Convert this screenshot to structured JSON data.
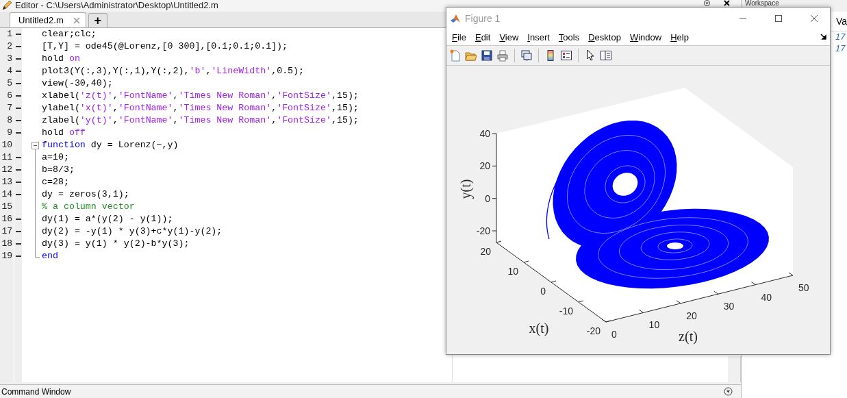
{
  "editor": {
    "title": "Editor - C:\\Users\\Administrator\\Desktop\\Untitled2.m",
    "tabs": [
      {
        "label": "Untitled2.m",
        "selected": true
      }
    ],
    "new_tab_button": "+",
    "lines": [
      {
        "number": "1",
        "executable": true,
        "segments": [
          {
            "kind": "plain",
            "text": "clear;clc;"
          }
        ]
      },
      {
        "number": "2",
        "executable": true,
        "segments": [
          {
            "kind": "plain",
            "text": "[T,Y] = ode45(@Lorenz,[0 300],[0.1;0.1;0.1]);"
          }
        ]
      },
      {
        "number": "3",
        "executable": true,
        "segments": [
          {
            "kind": "plain",
            "text": "hold "
          },
          {
            "kind": "string",
            "text": "on"
          }
        ]
      },
      {
        "number": "4",
        "executable": true,
        "segments": [
          {
            "kind": "plain",
            "text": "plot3(Y(:,3),Y(:,1),Y(:,2),"
          },
          {
            "kind": "string",
            "text": "'b'"
          },
          {
            "kind": "plain",
            "text": ","
          },
          {
            "kind": "string",
            "text": "'LineWidth'"
          },
          {
            "kind": "plain",
            "text": ",0.5);"
          }
        ]
      },
      {
        "number": "5",
        "executable": true,
        "segments": [
          {
            "kind": "plain",
            "text": "view(-30,40);"
          }
        ]
      },
      {
        "number": "6",
        "executable": true,
        "segments": [
          {
            "kind": "plain",
            "text": "xlabel("
          },
          {
            "kind": "string",
            "text": "'z(t)'"
          },
          {
            "kind": "plain",
            "text": ","
          },
          {
            "kind": "string",
            "text": "'FontName'"
          },
          {
            "kind": "plain",
            "text": ","
          },
          {
            "kind": "string",
            "text": "'Times New Roman'"
          },
          {
            "kind": "plain",
            "text": ","
          },
          {
            "kind": "string",
            "text": "'FontSize'"
          },
          {
            "kind": "plain",
            "text": ",15);"
          }
        ]
      },
      {
        "number": "7",
        "executable": true,
        "segments": [
          {
            "kind": "plain",
            "text": "ylabel("
          },
          {
            "kind": "string",
            "text": "'x(t)'"
          },
          {
            "kind": "plain",
            "text": ","
          },
          {
            "kind": "string",
            "text": "'FontName'"
          },
          {
            "kind": "plain",
            "text": ","
          },
          {
            "kind": "string",
            "text": "'Times New Roman'"
          },
          {
            "kind": "plain",
            "text": ","
          },
          {
            "kind": "string",
            "text": "'FontSize'"
          },
          {
            "kind": "plain",
            "text": ",15);"
          }
        ]
      },
      {
        "number": "8",
        "executable": true,
        "segments": [
          {
            "kind": "plain",
            "text": "zlabel("
          },
          {
            "kind": "string",
            "text": "'y(t)'"
          },
          {
            "kind": "plain",
            "text": ","
          },
          {
            "kind": "string",
            "text": "'FontName'"
          },
          {
            "kind": "plain",
            "text": ","
          },
          {
            "kind": "string",
            "text": "'Times New Roman'"
          },
          {
            "kind": "plain",
            "text": ","
          },
          {
            "kind": "string",
            "text": "'FontSize'"
          },
          {
            "kind": "plain",
            "text": ",15);"
          }
        ]
      },
      {
        "number": "9",
        "executable": true,
        "segments": [
          {
            "kind": "plain",
            "text": "hold "
          },
          {
            "kind": "string",
            "text": "off"
          }
        ]
      },
      {
        "number": "10",
        "executable": false,
        "kind": "fold_start",
        "segments": [
          {
            "kind": "keyword",
            "text": "function"
          },
          {
            "kind": "plain",
            "text": " dy = Lorenz(~,y)"
          }
        ]
      },
      {
        "number": "11",
        "executable": true,
        "kind": "fold_inside",
        "segments": [
          {
            "kind": "plain",
            "text": "a=10;"
          }
        ]
      },
      {
        "number": "12",
        "executable": true,
        "kind": "fold_inside",
        "segments": [
          {
            "kind": "plain",
            "text": "b=8/3;"
          }
        ]
      },
      {
        "number": "13",
        "executable": true,
        "kind": "fold_inside",
        "segments": [
          {
            "kind": "plain",
            "text": "c=28;"
          }
        ]
      },
      {
        "number": "14",
        "executable": true,
        "kind": "fold_inside",
        "segments": [
          {
            "kind": "plain",
            "text": "dy = zeros(3,1);"
          }
        ]
      },
      {
        "number": "15",
        "executable": false,
        "kind": "fold_inside",
        "segments": [
          {
            "kind": "comment",
            "text": "% a column vector"
          }
        ]
      },
      {
        "number": "16",
        "executable": true,
        "kind": "fold_inside",
        "segments": [
          {
            "kind": "plain",
            "text": "dy(1) = a*(y(2) - y(1));"
          }
        ]
      },
      {
        "number": "17",
        "executable": true,
        "kind": "fold_inside",
        "segments": [
          {
            "kind": "plain",
            "text": "dy(2) = -y(1) * y(3)+c*y(1)-y(2);"
          }
        ]
      },
      {
        "number": "18",
        "executable": true,
        "kind": "fold_inside",
        "segments": [
          {
            "kind": "plain",
            "text": "dy(3) = y(1) * y(2)-b*y(3);"
          }
        ]
      },
      {
        "number": "19",
        "executable": true,
        "kind": "fold_end",
        "segments": [
          {
            "kind": "keyword",
            "text": "end"
          }
        ]
      }
    ]
  },
  "workspace": {
    "title": "Workspace",
    "column_header": "Va",
    "values": [
      "17",
      "17"
    ]
  },
  "command_window": {
    "title": "Command Window"
  },
  "figure": {
    "title": "Figure 1",
    "menu": [
      {
        "label": "File",
        "mnemonic": true
      },
      {
        "label": "Edit",
        "mnemonic": true
      },
      {
        "label": "View",
        "mnemonic": true
      },
      {
        "label": "Insert",
        "mnemonic": true
      },
      {
        "label": "Tools",
        "mnemonic": true
      },
      {
        "label": "Desktop",
        "mnemonic": true
      },
      {
        "label": "Window",
        "mnemonic": true
      },
      {
        "label": "Help",
        "mnemonic": true
      }
    ],
    "axes": {
      "vertical_axis": {
        "label": "y(t)",
        "ticks": [
          "40",
          "20",
          "0",
          "-20"
        ]
      },
      "left_axis": {
        "label": "x(t)",
        "ticks": [
          "20",
          "10",
          "0",
          "-10",
          "-20"
        ]
      },
      "right_axis": {
        "label": "z(t)",
        "ticks": [
          "0",
          "10",
          "20",
          "30",
          "40",
          "50"
        ]
      }
    }
  }
}
